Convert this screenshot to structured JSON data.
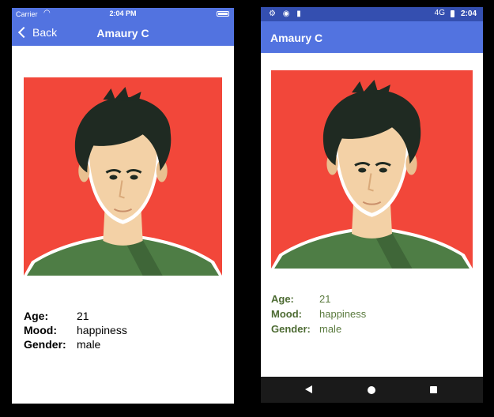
{
  "ios": {
    "status": {
      "carrier": "Carrier",
      "time": "2:04 PM",
      "wifi_icon": "wifi-icon",
      "battery_icon": "battery-icon"
    },
    "nav": {
      "back_label": "Back",
      "title": "Amaury C"
    },
    "details": [
      {
        "label": "Age:",
        "value": "21"
      },
      {
        "label": "Mood:",
        "value": "happiness"
      },
      {
        "label": "Gender:",
        "value": "male"
      }
    ]
  },
  "android": {
    "status": {
      "time": "2:04",
      "left_icons": "⚙ ◉ ▮",
      "network": "4G"
    },
    "appbar": {
      "title": "Amaury C"
    },
    "details": [
      {
        "label": "Age:",
        "value": "21"
      },
      {
        "label": "Mood:",
        "value": "happiness"
      },
      {
        "label": "Gender:",
        "value": "male"
      }
    ],
    "nav": [
      "back-icon",
      "home-icon",
      "recents-icon"
    ]
  },
  "colors": {
    "ios_bar": "#5273e0",
    "android_status": "#344fb0",
    "android_appbar": "#5273e0",
    "portrait_background": "#f2473a",
    "shirt": "#4e7d45",
    "skin": "#f3d1a6",
    "hair": "#1f2a22"
  }
}
